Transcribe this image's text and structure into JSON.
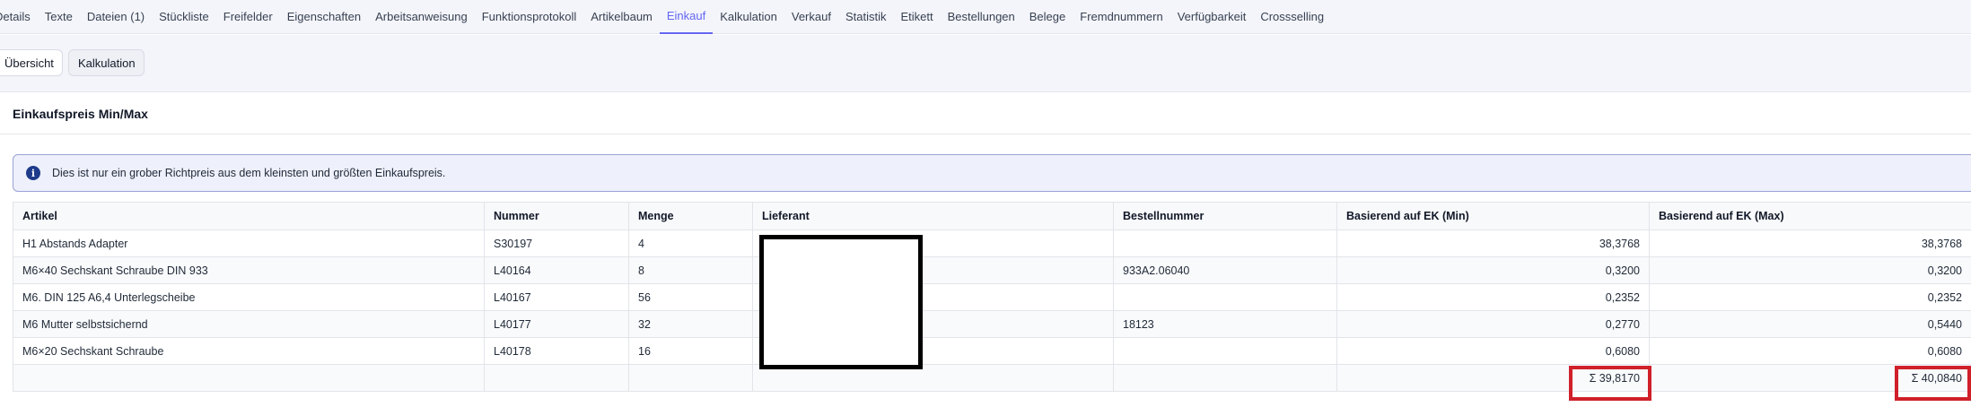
{
  "tabs": [
    {
      "label": "Details",
      "active": false
    },
    {
      "label": "Texte",
      "active": false
    },
    {
      "label": "Dateien (1)",
      "active": false
    },
    {
      "label": "Stückliste",
      "active": false
    },
    {
      "label": "Freifelder",
      "active": false
    },
    {
      "label": "Eigenschaften",
      "active": false
    },
    {
      "label": "Arbeitsanweisung",
      "active": false
    },
    {
      "label": "Funktionsprotokoll",
      "active": false
    },
    {
      "label": "Artikelbaum",
      "active": false
    },
    {
      "label": "Einkauf",
      "active": true
    },
    {
      "label": "Kalkulation",
      "active": false
    },
    {
      "label": "Verkauf",
      "active": false
    },
    {
      "label": "Statistik",
      "active": false
    },
    {
      "label": "Etikett",
      "active": false
    },
    {
      "label": "Bestellungen",
      "active": false
    },
    {
      "label": "Belege",
      "active": false
    },
    {
      "label": "Fremdnummern",
      "active": false
    },
    {
      "label": "Verfügbarkeit",
      "active": false
    },
    {
      "label": "Crossselling",
      "active": false
    }
  ],
  "subnav": {
    "overview": "Übersicht",
    "calculation": "Kalkulation"
  },
  "section": {
    "title": "Einkaufspreis Min/Max"
  },
  "info": {
    "icon": "info-icon",
    "text": "Dies ist nur ein grober Richtpreis aus dem kleinsten und größten Einkaufspreis."
  },
  "table": {
    "headers": [
      "Artikel",
      "Nummer",
      "Menge",
      "Lieferant",
      "Bestellnummer",
      "Basierend auf EK (Min)",
      "Basierend auf EK (Max)"
    ],
    "rows": [
      {
        "artikel": "H1 Abstands Adapter",
        "nummer": "S30197",
        "menge": "4",
        "lieferant": "",
        "bestellnummer": "",
        "min": "38,3768",
        "max": "38,3768"
      },
      {
        "artikel": "M6×40 Sechskant Schraube DIN 933",
        "nummer": "L40164",
        "menge": "8",
        "lieferant": "",
        "bestellnummer": "933A2.06040",
        "min": "0,3200",
        "max": "0,3200"
      },
      {
        "artikel": "M6. DIN 125 A6,4 Unterlegscheibe",
        "nummer": "L40167",
        "menge": "56",
        "lieferant": "",
        "bestellnummer": "",
        "min": "0,2352",
        "max": "0,2352"
      },
      {
        "artikel": "M6 Mutter selbstsichernd",
        "nummer": "L40177",
        "menge": "32",
        "lieferant": "",
        "bestellnummer": "18123",
        "min": "0,2770",
        "max": "0,5440"
      },
      {
        "artikel": "M6×20 Sechskant Schraube",
        "nummer": "L40178",
        "menge": "16",
        "lieferant": "",
        "bestellnummer": "",
        "min": "0,6080",
        "max": "0,6080"
      }
    ],
    "sum": {
      "min": "Σ 39,8170",
      "max": "Σ 40,0840"
    }
  },
  "colors": {
    "accent": "#6366f1",
    "highlight": "#d0202a",
    "info_bg": "#eef0fb",
    "info_icon": "#1e3a8a"
  }
}
